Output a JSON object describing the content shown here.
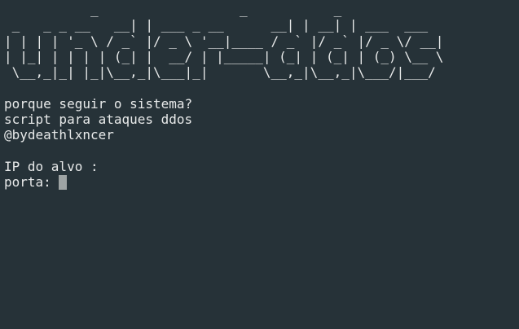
{
  "terminal": {
    "banner": "           _                  _           _\n _   _ _ __   __| | ___ _ __      __| | __| | ___  ___\n| | | | '_ \\ / _` |/ _ \\ '__|____ / _` |/ _` |/ _ \\/ __|\n| |_| | | | | (_| |  __/ | |_____| (_| | (_| | (_) \\__ \\\n \\__,_|_| |_|\\__,_|\\___|_|       \\__,_|\\__,_|\\___/|___/",
    "lines": [
      "porque seguir o sistema?",
      "script para ataques ddos",
      "@bydeathlxncer"
    ],
    "ip_prompt": "IP do alvo :",
    "port_prompt": "porta: ",
    "port_value": ""
  },
  "colors": {
    "background": "#263238",
    "foreground": "#e8eaea",
    "cursor": "#9ea4a4"
  }
}
